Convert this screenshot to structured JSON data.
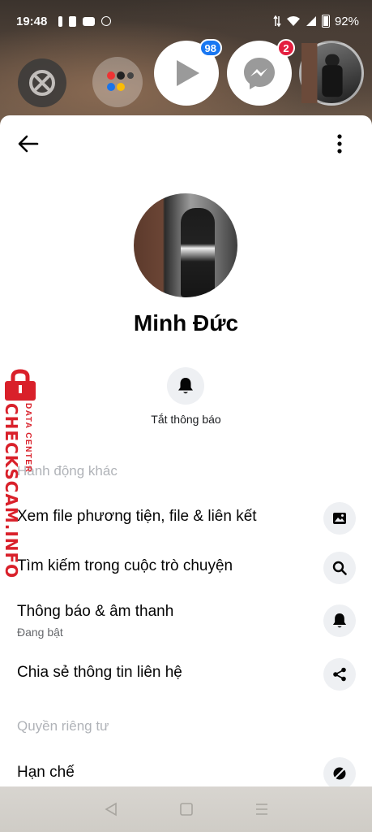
{
  "status_bar": {
    "time": "19:48",
    "battery_percent": "92%"
  },
  "bubbles": {
    "video_badge": "98",
    "messenger_badge": "2",
    "colors": {
      "video_badge": "#1877f2",
      "messenger_badge": "#e41e3f"
    }
  },
  "profile": {
    "name": "Minh Đức",
    "mute_label": "Tắt thông báo"
  },
  "sections": {
    "other_actions_title": "Hành động khác",
    "privacy_title": "Quyền riêng tư"
  },
  "menu": {
    "view_media": {
      "label": "Xem file phương tiện, file & liên kết",
      "icon": "image-icon"
    },
    "search_chat": {
      "label": "Tìm kiếm trong cuộc trò chuyện",
      "icon": "search-icon"
    },
    "notifications": {
      "label": "Thông báo & âm thanh",
      "sublabel": "Đang bật",
      "icon": "bell-icon"
    },
    "share_contact": {
      "label": "Chia sẻ thông tin liên hệ",
      "icon": "share-icon"
    },
    "restrict": {
      "label": "Hạn chế",
      "icon": "restrict-icon"
    }
  },
  "watermark": {
    "main": "CHECKSCAM.INFO",
    "sub": "DATA CENTER",
    "color": "#d9202a"
  },
  "theme": {
    "sheet_bg": "#ffffff",
    "icon_bg": "#eef0f3",
    "muted_text": "#b0b3b8"
  }
}
